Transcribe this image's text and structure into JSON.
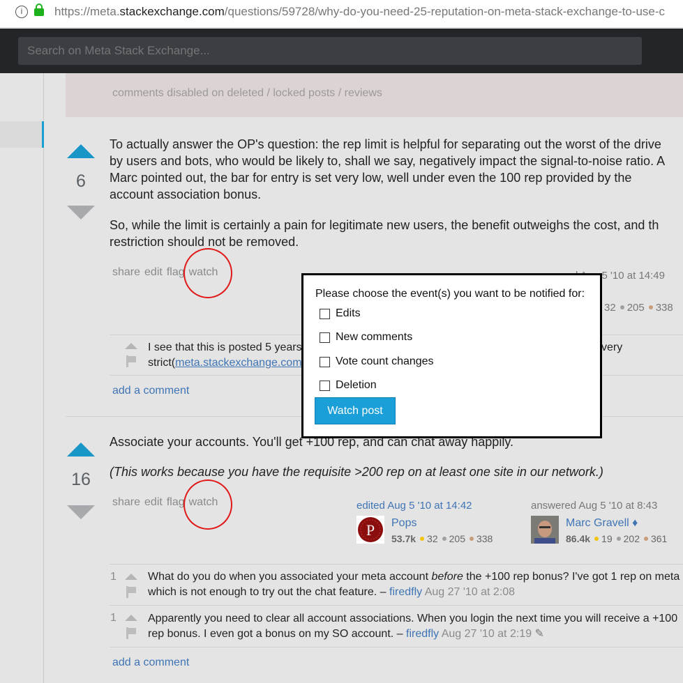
{
  "browser": {
    "url_prefix": "https://meta.",
    "url_domain": "stackexchange.com",
    "url_path": "/questions/59728/why-do-you-need-25-reputation-on-meta-stack-exchange-to-use-c"
  },
  "header": {
    "search_placeholder": "Search on Meta Stack Exchange..."
  },
  "notice": "comments disabled on deleted / locked posts / reviews",
  "answers": [
    {
      "votes": "6",
      "paragraphs": [
        "To actually answer the OP's question: the rep limit is helpful for separating out the worst of the drive",
        "by users and bots, who would be likely to, shall we say, negatively impact the signal-to-noise ratio. A",
        "Marc pointed out, the bar for entry is set very low, well under even the 100 rep provided by the",
        "account association bonus.",
        "So, while the limit is certainly a pain for legitimate new users, the benefit outweighs the cost, and th",
        "restriction should not be removed."
      ],
      "menu": [
        "share",
        "edit",
        "flag",
        "watch"
      ],
      "signature": {
        "action": "d Aug 5 '10 at 14:49",
        "gold": "32",
        "silver": "205",
        "bronze": "338"
      },
      "comments": [
        {
          "text": "I see that this is posted 5 years",
          "text2": "strict(",
          "link": "meta.stackexchange.com",
          "tail": "very"
        }
      ],
      "add_comment": "add a comment"
    },
    {
      "votes": "16",
      "paragraphs": [
        "Associate your accounts. You'll get +100 rep, and can chat away happily.",
        "(This works because you have the requisite >200 rep on at least one site in our network.)"
      ],
      "menu": [
        "share",
        "edit",
        "flag",
        "watch"
      ],
      "editor": {
        "action": "edited Aug 5 '10 at 14:42",
        "name": "Pops",
        "rep": "53.7k",
        "gold": "32",
        "silver": "205",
        "bronze": "338"
      },
      "owner": {
        "action": "answered Aug 5 '10 at 8:43",
        "name": "Marc Gravell",
        "mod": "♦",
        "rep": "86.4k",
        "gold": "19",
        "silver": "202",
        "bronze": "361"
      },
      "comments": [
        {
          "score": "1",
          "pre": "What do you do when you associated your meta account ",
          "em": "before",
          "post": " the +100 rep bonus? I've got 1 rep on meta",
          "line2": "which is not enough to try out the chat feature. – ",
          "user": "firedfly",
          "date": "Aug 27 '10 at 2:08"
        },
        {
          "score": "1",
          "line1": "Apparently you need to clear all account associations. When you login the next time you will receive a +100",
          "line2": "rep bonus. I even got a bonus on my SO account. – ",
          "user": "firedfly",
          "date": "Aug 27 '10 at 2:19"
        }
      ],
      "add_comment": "add a comment"
    }
  ],
  "dialog": {
    "prompt": "Please choose the event(s) you want to be notified for:",
    "options": [
      {
        "label": "Edits",
        "checked": false
      },
      {
        "label": "New comments",
        "checked": false
      },
      {
        "label": "Vote count changes",
        "checked": false
      },
      {
        "label": "Deletion",
        "checked": false
      }
    ],
    "button": "Watch post"
  },
  "colors": {
    "accent": "#1a9fd8",
    "annotation": "#e01818",
    "gold": "#f1c40f",
    "silver": "#a0a0a0",
    "bronze": "#c69c7a"
  }
}
